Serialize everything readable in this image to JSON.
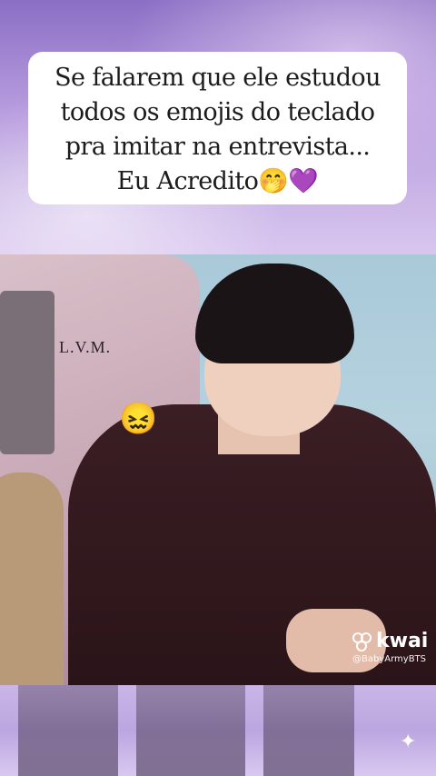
{
  "caption": {
    "line1": "Se falarem que ele estudou",
    "line2": "todos os emojis do teclado",
    "line3": "pra imitar na entrevista...",
    "line4": "Eu Acredito🤭💜"
  },
  "video": {
    "jacket_text": "L.V.M.",
    "reaction_emoji": "😖"
  },
  "watermark": {
    "brand": "kwai",
    "handle": "@BabyArmyBTS"
  },
  "colors": {
    "banner_top": "#8a6fc4",
    "banner_bottom": "#d9c6ef",
    "caption_bg": "#ffffff",
    "bottom_strip": "#c9b6e7"
  },
  "icons": [
    "kwai-logo-icon",
    "sparkle-icon"
  ]
}
